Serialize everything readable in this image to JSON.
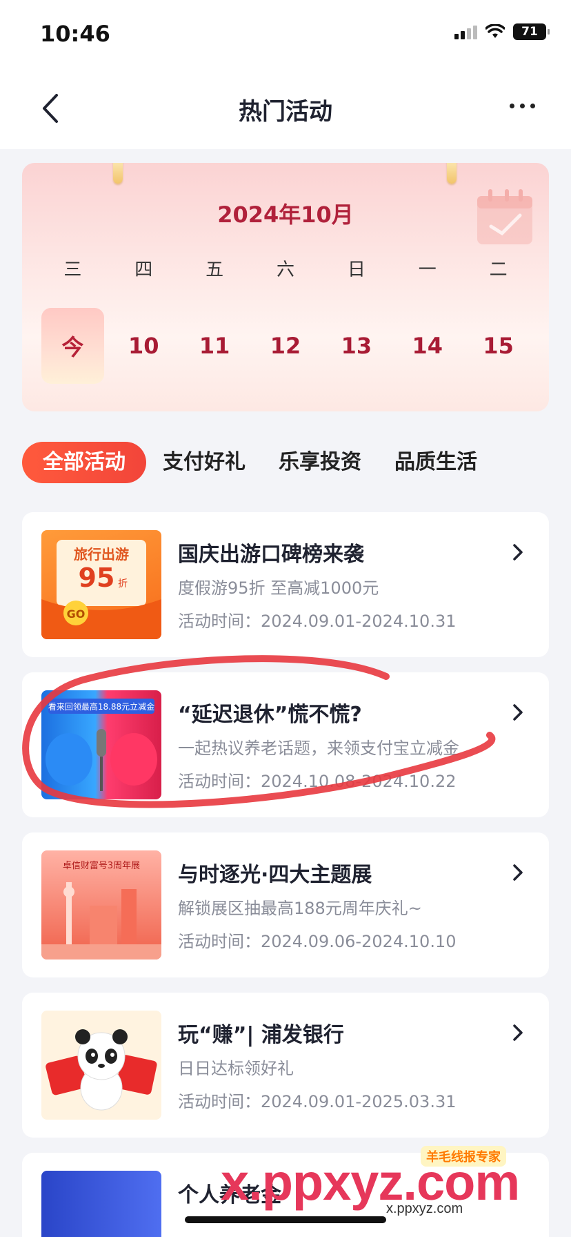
{
  "status_bar": {
    "time": "10:46",
    "battery": "71"
  },
  "nav": {
    "title": "热门活动"
  },
  "calendar": {
    "month": "2024年10月",
    "weekdays": [
      "三",
      "四",
      "五",
      "六",
      "日",
      "一",
      "二"
    ],
    "days": [
      "今",
      "10",
      "11",
      "12",
      "13",
      "14",
      "15"
    ]
  },
  "tabs": [
    "全部活动",
    "支付好礼",
    "乐享投资",
    "品质生活"
  ],
  "cards": [
    {
      "title": "国庆出游口碑榜来袭",
      "desc": "度假游95折 至高减1000元",
      "period": "活动时间：2024.09.01-2024.10.31",
      "thumb_text": "旅行出游 95折"
    },
    {
      "title": "“延迟退休”慌不慌?",
      "desc": "一起热议养老话题，来领支付宝立减金",
      "period": "活动时间：2024.10.08-2024.10.22",
      "thumb_text": "看来回领最高18.88元立减金"
    },
    {
      "title": "与时逐光·四大主题展",
      "desc": "解锁展区抽最高188元周年庆礼~",
      "period": "活动时间：2024.09.06-2024.10.10",
      "thumb_text": "卓信财富号3周年展"
    },
    {
      "title": "玩“赚”| 浦发银行",
      "desc": "日日达标领好礼",
      "period": "活动时间：2024.09.01-2025.03.31"
    },
    {
      "title": "个人养老金",
      "desc": "",
      "period": ""
    }
  ],
  "watermark": {
    "main": "x.ppxyz.com",
    "small": "x.ppxyz.com",
    "badge": "羊毛线报专家"
  },
  "colors": {
    "accent": "#f2453a",
    "date_red": "#a81b34",
    "annotation": "#e8383f"
  }
}
